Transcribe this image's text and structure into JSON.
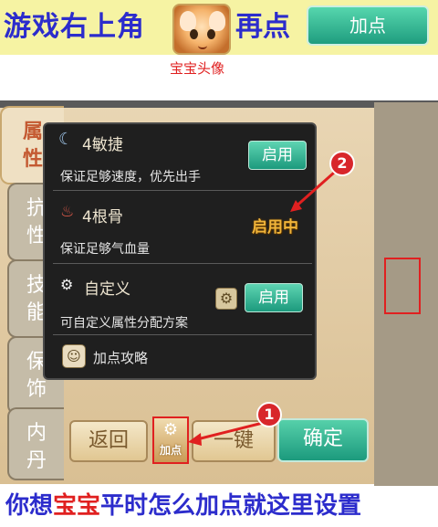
{
  "banner": {
    "title_left": "游戏右上角",
    "title_right": "再点",
    "button_label": "加点",
    "avatar_caption": "宝宝头像"
  },
  "side_tabs": [
    {
      "label": "属\n性",
      "active": true
    },
    {
      "label": "抗\n性",
      "active": false
    },
    {
      "label": "技\n能",
      "active": false
    },
    {
      "label": "保\n饰",
      "active": false
    },
    {
      "label": "内\n丹",
      "active": false
    }
  ],
  "panel": {
    "section1": {
      "title": "4敏捷",
      "desc": "保证足够速度，优先出手",
      "button": "启用"
    },
    "section2": {
      "title": "4根骨",
      "desc": "保证足够气血量",
      "status": "启用中"
    },
    "section3": {
      "title": "自定义",
      "desc": "可自定义属性分配方案",
      "button": "启用"
    },
    "guide": {
      "label": "加点攻略"
    }
  },
  "bottom_buttons": {
    "back": "返回",
    "jiadian": "加点",
    "one_key": "一键",
    "confirm": "确定"
  },
  "markers": [
    "1",
    "2"
  ],
  "bottom_caption": {
    "part1": "你想",
    "highlight": "宝宝",
    "part2": "平时怎么加点就这里设置"
  },
  "colors": {
    "banner_bg": "#f6f3a3",
    "title_blue": "#2c2ccc",
    "highlight_red": "#e02020",
    "accent_green": "#1c9a7d",
    "status_gold": "#f0b43a"
  }
}
